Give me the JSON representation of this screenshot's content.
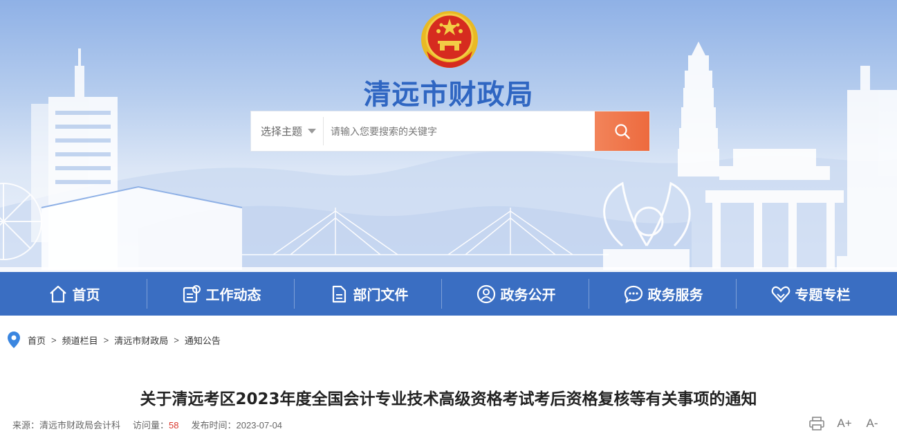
{
  "top_links": [
    "",
    ""
  ],
  "site": {
    "title": "清远市财政局"
  },
  "search": {
    "select_label": "选择主题",
    "placeholder": "请输入您要搜索的关键字",
    "icon": "search-icon"
  },
  "nav": [
    {
      "label": "首页",
      "icon": "home-icon"
    },
    {
      "label": "工作动态",
      "icon": "news-icon"
    },
    {
      "label": "部门文件",
      "icon": "document-icon"
    },
    {
      "label": "政务公开",
      "icon": "user-icon"
    },
    {
      "label": "政务服务",
      "icon": "chat-icon"
    },
    {
      "label": "专题专栏",
      "icon": "heart-icon"
    }
  ],
  "breadcrumb": {
    "icon": "location-pin-icon",
    "items": [
      "首页",
      "频道栏目",
      "清远市财政局",
      "通知公告"
    ],
    "separator": ">"
  },
  "article": {
    "title": "关于清远考区2023年度全国会计专业技术高级资格考试考后资格复核等有关事项的通知",
    "source_label": "来源：",
    "source": "清远市财政局会计科",
    "views_label": "访问量：",
    "views": "58",
    "date_label": "发布时间：",
    "date": "2023-07-04"
  },
  "tools": {
    "print_icon": "print-icon",
    "font_increase": "A+",
    "font_decrease": "A-"
  },
  "colors": {
    "nav_bg": "#3a6ec2",
    "title_blue": "#2f66c2",
    "search_button": "#ed6a3e",
    "view_count": "#d9362c"
  }
}
